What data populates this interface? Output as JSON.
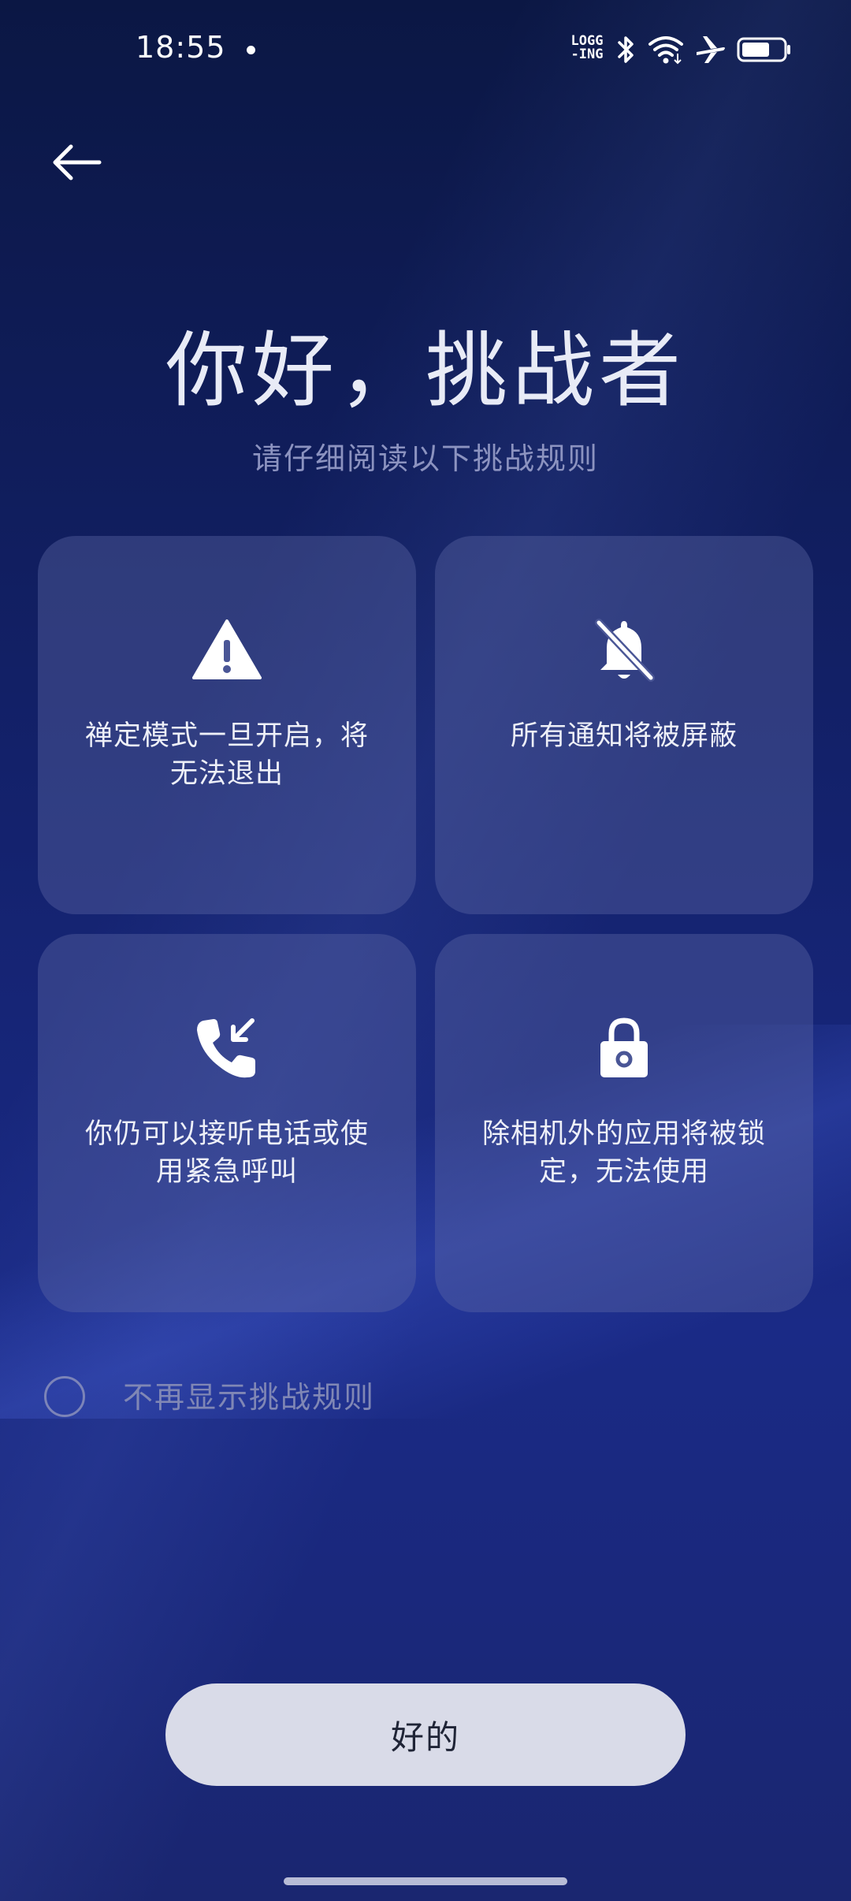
{
  "status_bar": {
    "time": "18:55",
    "logging_line1": "LOGG",
    "logging_line2": "-ING",
    "icons": [
      "bluetooth-icon",
      "wifi-icon",
      "airplane-mode-icon",
      "battery-icon"
    ]
  },
  "header": {
    "back_icon": "arrow-left-icon"
  },
  "intro": {
    "title": "你好，挑战者",
    "subtitle": "请仔细阅读以下挑战规则"
  },
  "rules": [
    {
      "icon": "warning-icon",
      "line1": "禅定模式一旦开启，将",
      "line2": "无法退出"
    },
    {
      "icon": "bell-off-icon",
      "line1": "所有通知将被屏蔽",
      "line2": ""
    },
    {
      "icon": "incoming-call-icon",
      "line1": "你仍可以接听电话或使",
      "line2": "用紧急呼叫"
    },
    {
      "icon": "lock-icon",
      "line1": "除相机外的应用将被锁",
      "line2": "定，无法使用"
    }
  ],
  "checkbox": {
    "label": "不再显示挑战规则",
    "checked": false
  },
  "ok_button": {
    "label": "好的"
  },
  "colors": {
    "background_top": "#0b1744",
    "background_bottom": "#1a2a86",
    "card": "#606ca8",
    "button": "#d9dbe8",
    "subtitle": "#8c93c0"
  }
}
